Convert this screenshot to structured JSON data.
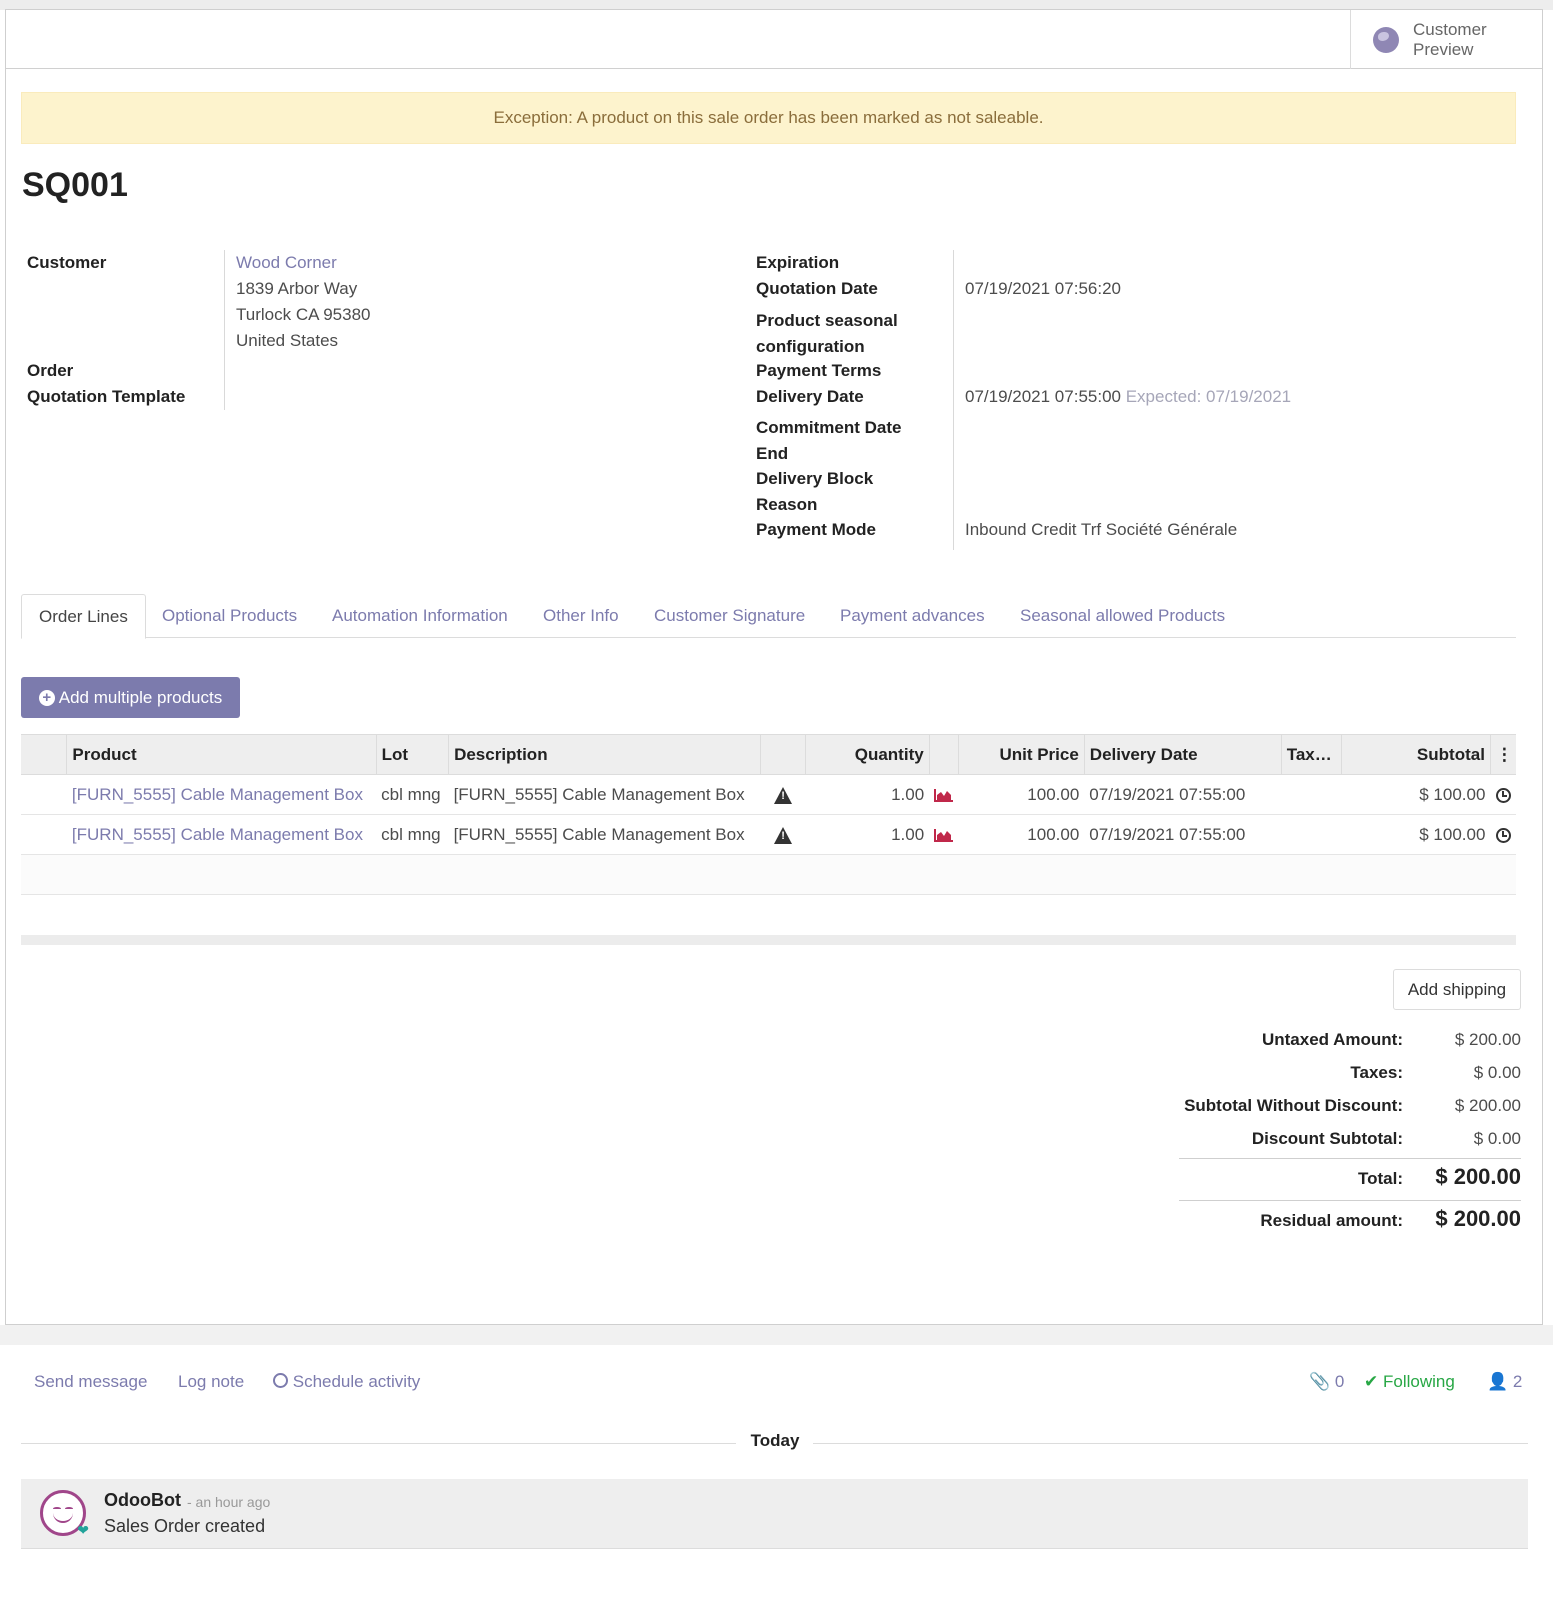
{
  "header": {
    "customer_preview_label": "Customer Preview"
  },
  "alert": {
    "text": "Exception: A product on this sale order has been marked as not saleable."
  },
  "record": {
    "title": "SQ001"
  },
  "left_fields": {
    "customer_label": "Customer",
    "customer_name": "Wood Corner",
    "address_line1": "1839 Arbor Way",
    "address_line2": "Turlock CA 95380",
    "address_line3": "United States",
    "order_label": "Order",
    "quotation_template_label": "Quotation Template"
  },
  "right_fields": {
    "expiration_label": "Expiration",
    "quotation_date_label": "Quotation Date",
    "quotation_date_value": "07/19/2021 07:56:20",
    "product_seasonal_label_1": "Product seasonal",
    "product_seasonal_label_2": "configuration",
    "payment_terms_label": "Payment Terms",
    "delivery_date_label": "Delivery Date",
    "delivery_date_value": "07/19/2021 07:55:00",
    "delivery_expected": "Expected: 07/19/2021",
    "commitment_date_label_1": "Commitment Date",
    "commitment_date_label_2": "End",
    "delivery_block_label_1": "Delivery Block",
    "delivery_block_label_2": "Reason",
    "payment_mode_label": "Payment Mode",
    "payment_mode_value": "Inbound Credit Trf Société Générale"
  },
  "tabs": [
    {
      "label": "Order Lines",
      "active": true
    },
    {
      "label": "Optional Products"
    },
    {
      "label": "Automation Information"
    },
    {
      "label": "Other Info"
    },
    {
      "label": "Customer Signature"
    },
    {
      "label": "Payment advances"
    },
    {
      "label": "Seasonal allowed Products"
    }
  ],
  "order_lines": {
    "add_multiple_label": "Add multiple products",
    "columns": {
      "product": "Product",
      "lot": "Lot",
      "description": "Description",
      "quantity": "Quantity",
      "unit_price": "Unit Price",
      "delivery_date": "Delivery Date",
      "taxes": "Tax…",
      "subtotal": "Subtotal"
    },
    "rows": [
      {
        "product": "[FURN_5555] Cable Management Box",
        "lot": "cbl mng",
        "description": "[FURN_5555] Cable Management Box",
        "quantity": "1.00",
        "unit_price": "100.00",
        "delivery_date": "07/19/2021 07:55:00",
        "taxes": "",
        "subtotal": "$ 100.00"
      },
      {
        "product": "[FURN_5555] Cable Management Box",
        "lot": "cbl mng",
        "description": "[FURN_5555] Cable Management Box",
        "quantity": "1.00",
        "unit_price": "100.00",
        "delivery_date": "07/19/2021 07:55:00",
        "taxes": "",
        "subtotal": "$ 100.00"
      }
    ],
    "icons": {
      "warning": "warning-triangle-icon",
      "forecast": "area-chart-icon",
      "history": "clock-icon",
      "options": "vertical-ellipsis-icon"
    },
    "colors": {
      "forecast_icon": "#c0284a"
    }
  },
  "totals": {
    "add_shipping_label": "Add shipping",
    "untaxed_label": "Untaxed Amount:",
    "untaxed_value": "$ 200.00",
    "taxes_label": "Taxes:",
    "taxes_value": "$ 0.00",
    "subtotal_wo_discount_label": "Subtotal Without Discount:",
    "subtotal_wo_discount_value": "$ 200.00",
    "discount_subtotal_label": "Discount Subtotal:",
    "discount_subtotal_value": "$ 0.00",
    "total_label": "Total:",
    "total_value": "$ 200.00",
    "residual_label": "Residual amount:",
    "residual_value": "$ 200.00"
  },
  "chatter": {
    "send_message": "Send message",
    "log_note": "Log note",
    "schedule_activity": "Schedule activity",
    "attachments_count": "0",
    "following_label": "Following",
    "followers_count": "2",
    "day_separator": "Today",
    "messages": [
      {
        "author": "OdooBot",
        "time": "- an hour ago",
        "body": "Sales Order created"
      }
    ]
  },
  "colors": {
    "brand": "#7c7bad",
    "alert_bg": "#fdf3cd",
    "alert_text": "#8a6d3b",
    "following": "#28a745"
  }
}
